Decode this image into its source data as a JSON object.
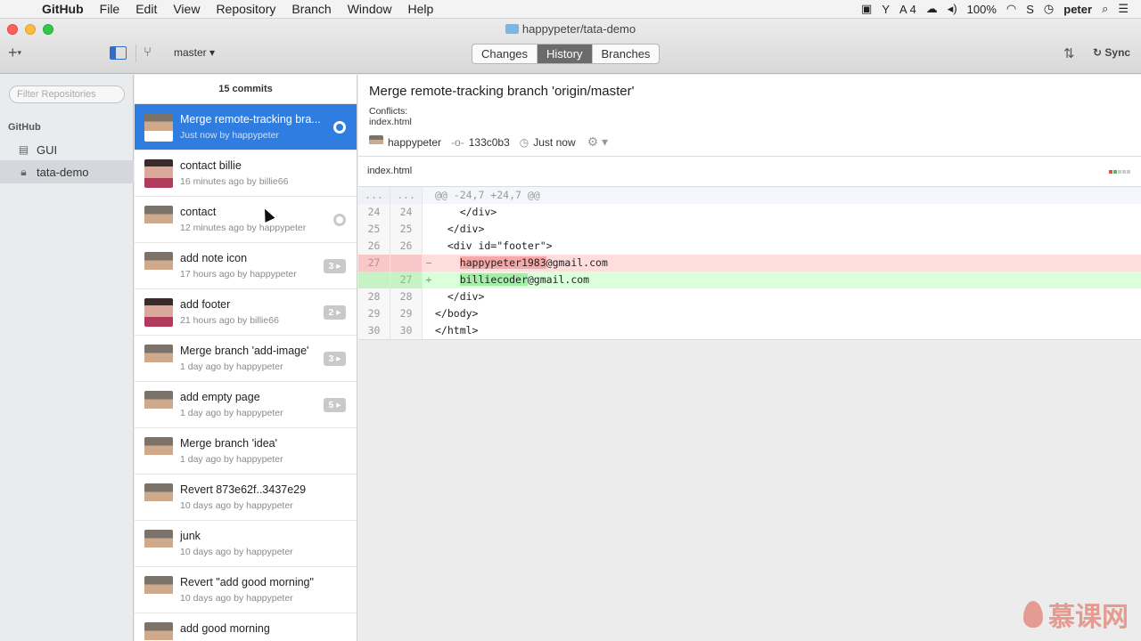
{
  "menubar": {
    "app": "GitHub",
    "items": [
      "File",
      "Edit",
      "View",
      "Repository",
      "Branch",
      "Window",
      "Help"
    ],
    "status": {
      "workspace": "4",
      "battery": "100%",
      "user": "peter"
    }
  },
  "window": {
    "title": "happypeter/tata-demo",
    "branch": "master",
    "tabs": [
      "Changes",
      "History",
      "Branches"
    ],
    "active_tab": "History",
    "sync_label": "Sync"
  },
  "repos": {
    "filter_placeholder": "Filter Repositories",
    "group": "GitHub",
    "items": [
      {
        "name": "GUI",
        "icon": "book-icon"
      },
      {
        "name": "tata-demo",
        "icon": "lock-icon"
      }
    ]
  },
  "commits": {
    "count_label": "15 commits",
    "items": [
      {
        "title": "Merge remote-tracking bra...",
        "meta": "Just now by happypeter",
        "avatar": "happy",
        "marker": "ring",
        "selected": true
      },
      {
        "title": "contact billie",
        "meta": "16 minutes ago by billie66",
        "avatar": "billie",
        "marker": "",
        "selected": false
      },
      {
        "title": "contact",
        "meta": "12 minutes ago by happypeter",
        "avatar": "happy",
        "marker": "ring",
        "selected": false
      },
      {
        "title": "add note icon",
        "meta": "17 hours ago by happypeter",
        "avatar": "happy",
        "marker": "3 ▸",
        "selected": false
      },
      {
        "title": "add footer",
        "meta": "21 hours ago by billie66",
        "avatar": "billie",
        "marker": "2 ▸",
        "selected": false
      },
      {
        "title": "Merge branch 'add-image'",
        "meta": "1 day ago by happypeter",
        "avatar": "happy",
        "marker": "3 ▸",
        "selected": false
      },
      {
        "title": "add empty page",
        "meta": "1 day ago by happypeter",
        "avatar": "happy",
        "marker": "5 ▸",
        "selected": false
      },
      {
        "title": "Merge branch 'idea'",
        "meta": "1 day ago by happypeter",
        "avatar": "happy",
        "marker": "",
        "selected": false
      },
      {
        "title": "Revert 873e62f..3437e29",
        "meta": "10 days ago by happypeter",
        "avatar": "happy",
        "marker": "",
        "selected": false
      },
      {
        "title": "junk",
        "meta": "10 days ago by happypeter",
        "avatar": "happy",
        "marker": "",
        "selected": false
      },
      {
        "title": "Revert \"add good morning\"",
        "meta": "10 days ago by happypeter",
        "avatar": "happy",
        "marker": "",
        "selected": false
      },
      {
        "title": "add good morning",
        "meta": "",
        "avatar": "happy",
        "marker": "",
        "selected": false
      }
    ]
  },
  "detail": {
    "title": "Merge remote-tracking branch 'origin/master'",
    "conflicts_label": "Conflicts:",
    "conflict_file": "index.html",
    "author": "happypeter",
    "sha": "133c0b3",
    "time": "Just now",
    "file": "index.html",
    "diff": [
      {
        "type": "hunk",
        "old": "...",
        "new": "...",
        "sign": "",
        "pre": "@@ -24,7 +24,7 @@",
        "hl": "",
        "post": ""
      },
      {
        "type": "ctx",
        "old": "24",
        "new": "24",
        "sign": "",
        "pre": "    </div>",
        "hl": "",
        "post": ""
      },
      {
        "type": "ctx",
        "old": "25",
        "new": "25",
        "sign": "",
        "pre": "  </div>",
        "hl": "",
        "post": ""
      },
      {
        "type": "ctx",
        "old": "26",
        "new": "26",
        "sign": "",
        "pre": "  <div id=\"footer\">",
        "hl": "",
        "post": ""
      },
      {
        "type": "del",
        "old": "27",
        "new": "",
        "sign": "−",
        "pre": "    ",
        "hl": "happypeter1983",
        "post": "@gmail.com"
      },
      {
        "type": "add",
        "old": "",
        "new": "27",
        "sign": "+",
        "pre": "    ",
        "hl": "billiecoder",
        "post": "@gmail.com"
      },
      {
        "type": "ctx",
        "old": "28",
        "new": "28",
        "sign": "",
        "pre": "  </div>",
        "hl": "",
        "post": ""
      },
      {
        "type": "ctx",
        "old": "29",
        "new": "29",
        "sign": "",
        "pre": "</body>",
        "hl": "",
        "post": ""
      },
      {
        "type": "ctx",
        "old": "30",
        "new": "30",
        "sign": "",
        "pre": "</html>",
        "hl": "",
        "post": ""
      }
    ]
  },
  "watermark": "慕课网",
  "colors": {
    "selection": "#2f7de1",
    "deleted": "#ffdddd",
    "added": "#dbffdb",
    "watermark": "#e15a4a"
  }
}
